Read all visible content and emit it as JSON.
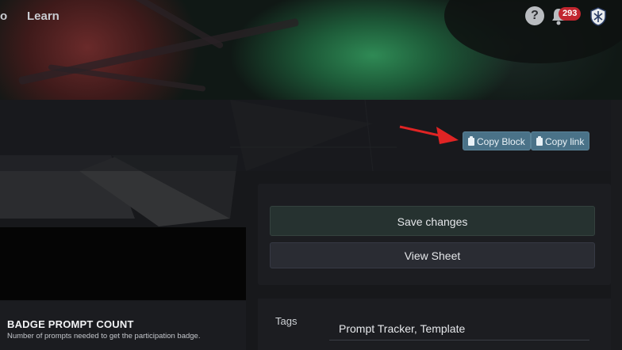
{
  "nav": {
    "items": [
      "o",
      "Learn"
    ]
  },
  "header": {
    "help_glyph": "?",
    "notifications_count": "293"
  },
  "toolbar": {
    "copy_block_label": "Copy Block",
    "copy_link_label": "Copy link"
  },
  "actions": {
    "save_label": "Save changes",
    "view_sheet_label": "View Sheet"
  },
  "badge_prompt": {
    "title": "BADGE PROMPT COUNT",
    "description": "Number of prompts needed to get the participation badge."
  },
  "tags": {
    "label": "Tags",
    "value": "Prompt Tracker, Template"
  },
  "colors": {
    "accent": "#4a7288",
    "notification": "#c1262f",
    "arrow": "#e02424"
  }
}
